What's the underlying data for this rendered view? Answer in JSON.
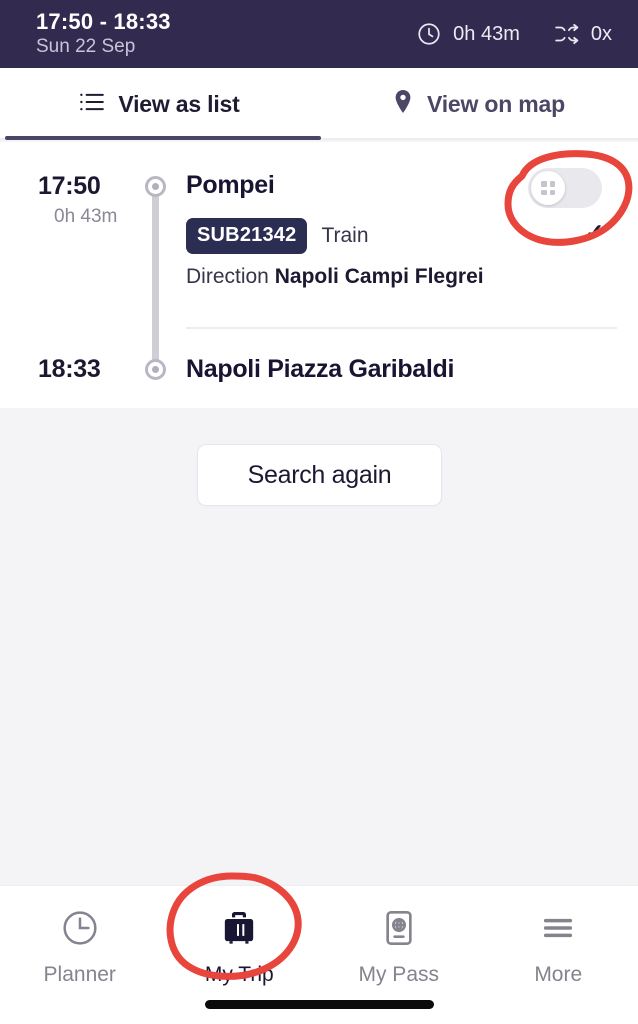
{
  "header": {
    "title": "17:50 - 18:33",
    "subtitle": "Sun 22 Sep",
    "duration": "0h 43m",
    "transfers": "0x",
    "clock_icon": "clock-icon",
    "transfer_icon": "shuffle-icon",
    "background_color": "#332b4f"
  },
  "tabs": [
    {
      "label": "View as list",
      "icon": "list-icon",
      "active": true
    },
    {
      "label": "View on map",
      "icon": "map-pin-icon",
      "active": false
    }
  ],
  "trip": {
    "departure": {
      "time": "17:50",
      "duration": "0h 43m",
      "stop": "Pompei"
    },
    "arrival": {
      "time": "18:33",
      "stop": "Napoli Piazza Garibaldi"
    },
    "line_badge": "SUB21342",
    "mode": "Train",
    "direction_label": "Direction",
    "direction_value": "Napoli Campi Flegrei",
    "badge_color": "#2b2d52",
    "toggle": {
      "name": "trip-expand-toggle",
      "state": "off",
      "knob_icon": "grid-dots-icon"
    },
    "check_icon": "check-icon"
  },
  "actions": {
    "search_again": "Search again"
  },
  "bottom_nav": [
    {
      "label": "Planner",
      "icon": "clock-icon",
      "active": false
    },
    {
      "label": "My Trip",
      "icon": "suitcase-icon",
      "active": true
    },
    {
      "label": "My Pass",
      "icon": "passport-icon",
      "active": false
    },
    {
      "label": "More",
      "icon": "hamburger-icon",
      "active": false
    }
  ],
  "annotations": {
    "color": "#e8453c",
    "items": [
      {
        "name": "toggle-highlight",
        "shape": "ellipse"
      },
      {
        "name": "my-trip-highlight",
        "shape": "ellipse"
      }
    ]
  }
}
